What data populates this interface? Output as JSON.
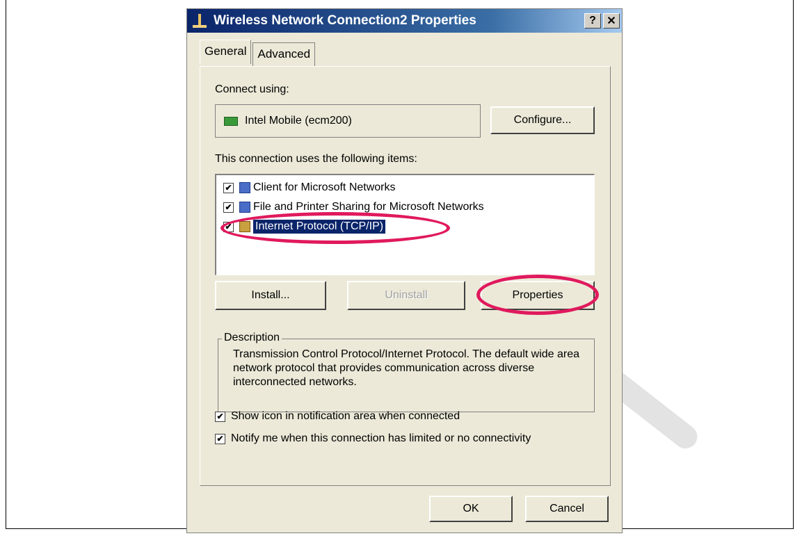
{
  "window": {
    "title": "Wireless Network Connection2 Properties",
    "help_btn": "?",
    "close_btn": "✕"
  },
  "tabs": [
    {
      "label": "General",
      "active": true
    },
    {
      "label": "Advanced",
      "active": false
    }
  ],
  "connect_using": {
    "label": "Connect using:",
    "adapter": "Intel Mobile (ecm200)",
    "configure_label": "Configure..."
  },
  "items_section": {
    "label": "This connection uses the following items:",
    "items": [
      {
        "label": "Client for Microsoft Networks",
        "checked": true,
        "selected": false,
        "check_mark": "✔"
      },
      {
        "label": "File and Printer Sharing for Microsoft Networks",
        "checked": true,
        "selected": false,
        "check_mark": "✔"
      },
      {
        "label": "Internet Protocol (TCP/IP)",
        "checked": true,
        "selected": true,
        "check_mark": "✔"
      }
    ]
  },
  "buttons": {
    "install": "Install...",
    "uninstall": "Uninstall",
    "properties": "Properties",
    "ok": "OK",
    "cancel": "Cancel"
  },
  "description": {
    "legend": "Description",
    "text": "Transmission Control Protocol/Internet Protocol. The default wide area network protocol that provides communication across diverse interconnected networks."
  },
  "options": [
    {
      "label": "Show icon in notification area when connected",
      "checked": true,
      "check_mark": "✔"
    },
    {
      "label": "Notify me when this connection has limited or no connectivity",
      "checked": true,
      "check_mark": "✔"
    }
  ],
  "colors": {
    "highlight_oval": "#e0195d",
    "titlebar": "#0a246a",
    "dialog_bg": "#ece9d8",
    "selection": "#0a246a"
  }
}
